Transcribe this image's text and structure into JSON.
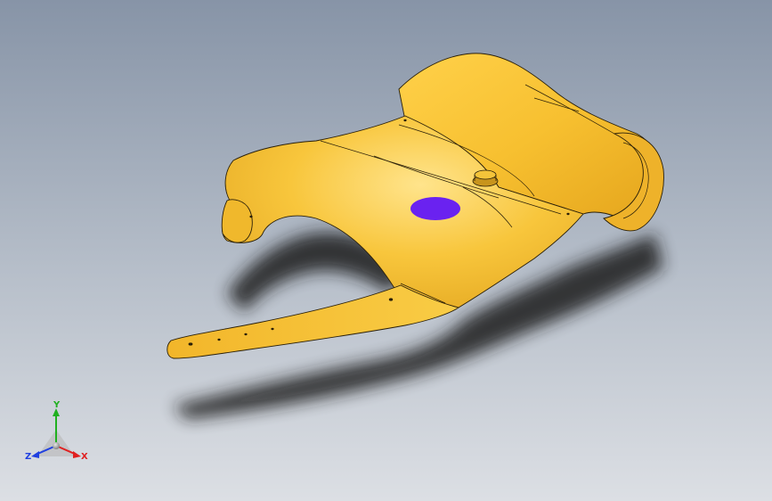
{
  "viewport": {
    "background_top": "#8a98aa",
    "background_bottom": "#d8dce2"
  },
  "model": {
    "part_color": "#f6c236",
    "part_highlight": "#ffe58a",
    "part_shade": "#d99a14",
    "edge_color": "#2a1f08",
    "hole_marker_color": "#6a22f0"
  },
  "triad": {
    "x_label": "X",
    "y_label": "Y",
    "z_label": "Z",
    "x_color": "#e02020",
    "y_color": "#20b020",
    "z_color": "#2040e0"
  }
}
